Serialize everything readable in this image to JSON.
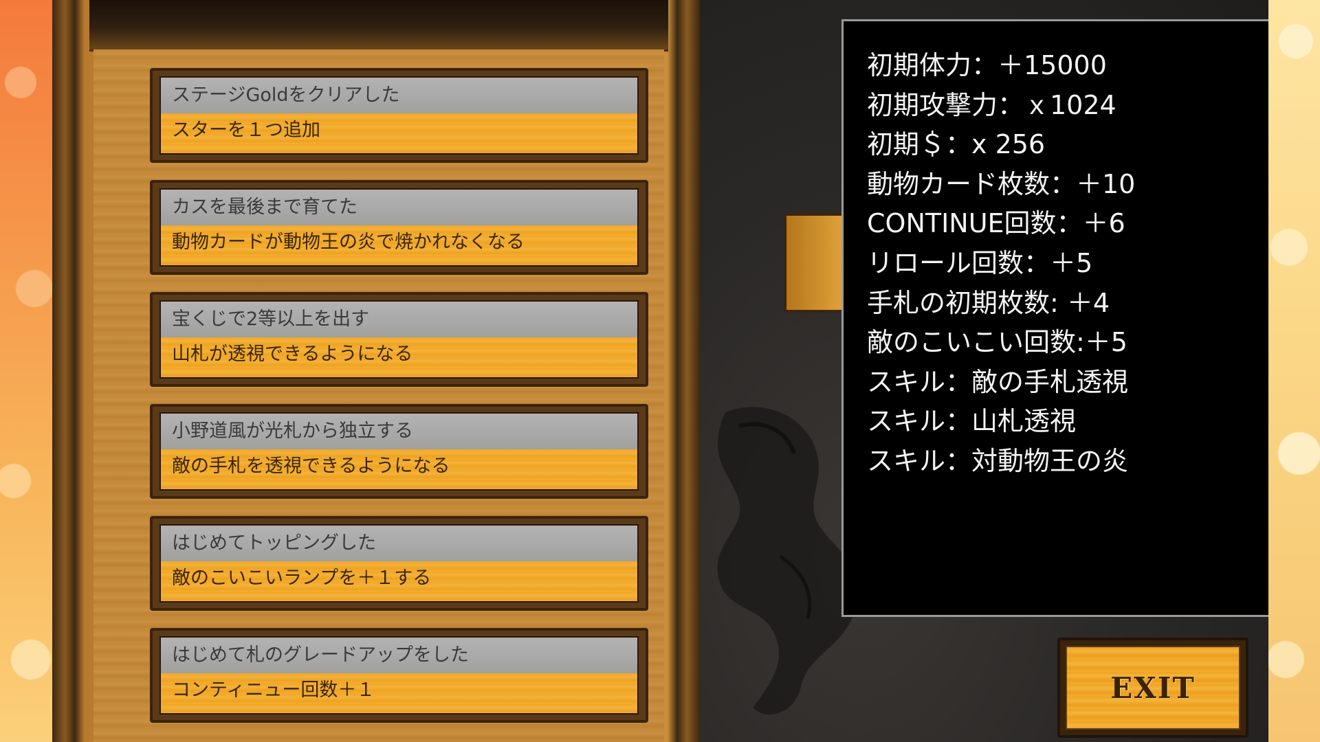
{
  "achievements": [
    {
      "title": "ステージGoldをクリアした",
      "reward": "スターを１つ追加"
    },
    {
      "title": "カスを最後まで育てた",
      "reward": "動物カードが動物王の炎で焼かれなくなる"
    },
    {
      "title": "宝くじで2等以上を出す",
      "reward": "山札が透視できるようになる"
    },
    {
      "title": "小野道風が光札から独立する",
      "reward": "敵の手札を透視できるようになる"
    },
    {
      "title": "はじめてトッピングした",
      "reward": "敵のこいこいランプを＋１する"
    },
    {
      "title": "はじめて札のグレードアップをした",
      "reward": "コンティニュー回数＋１"
    }
  ],
  "stats": [
    "初期体力：＋15000",
    "初期攻撃力：ｘ1024",
    "初期＄：x 256",
    "動物カード枚数：＋10",
    "CONTINUE回数：＋6",
    "リロール回数：＋5",
    "手札の初期枚数: ＋4",
    "敵のこいこい回数:＋5",
    "スキル：敵の手札透視",
    "スキル：山札透視",
    "スキル：対動物王の炎"
  ],
  "exit_button": {
    "label": "EXIT"
  },
  "colors": {
    "card_title_bg": "#a8a8a8",
    "card_reward_bg": "#f0a726",
    "wood": "#c48938",
    "stats_bg": "#000000",
    "stats_text": "#f4f4f4"
  },
  "icons": [
    "dragon-silhouette",
    "side-tab-glyph"
  ]
}
